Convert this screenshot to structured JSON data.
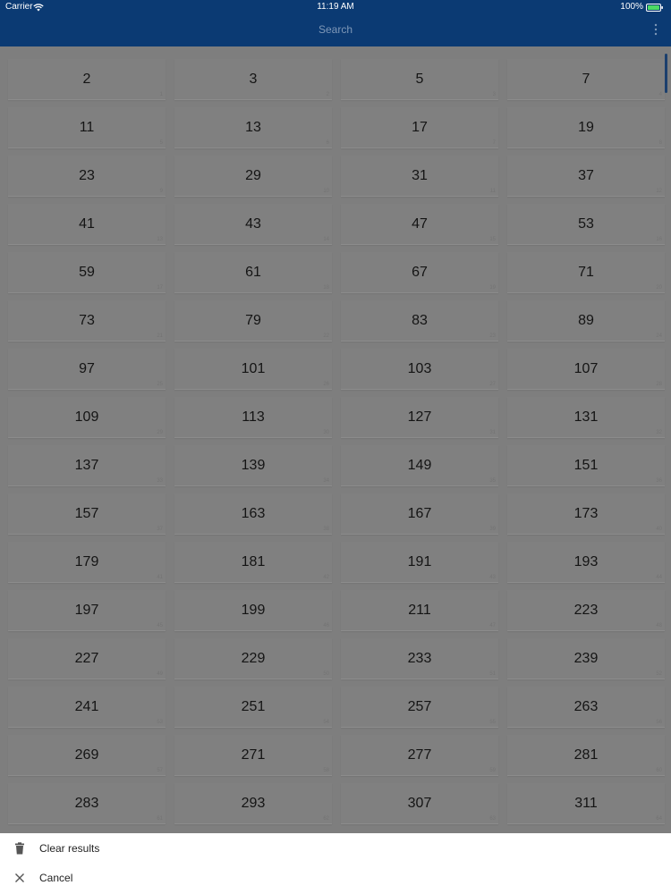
{
  "status_bar": {
    "carrier": "Carrier",
    "time": "11:19 AM",
    "battery": "100%"
  },
  "app_bar": {
    "title": "Search"
  },
  "grid": {
    "items": [
      {
        "value": "2",
        "index": "1"
      },
      {
        "value": "3",
        "index": "2"
      },
      {
        "value": "5",
        "index": "3"
      },
      {
        "value": "7",
        "index": "4"
      },
      {
        "value": "11",
        "index": "5"
      },
      {
        "value": "13",
        "index": "6"
      },
      {
        "value": "17",
        "index": "7"
      },
      {
        "value": "19",
        "index": "8"
      },
      {
        "value": "23",
        "index": "9"
      },
      {
        "value": "29",
        "index": "10"
      },
      {
        "value": "31",
        "index": "11"
      },
      {
        "value": "37",
        "index": "12"
      },
      {
        "value": "41",
        "index": "13"
      },
      {
        "value": "43",
        "index": "14"
      },
      {
        "value": "47",
        "index": "15"
      },
      {
        "value": "53",
        "index": "16"
      },
      {
        "value": "59",
        "index": "17"
      },
      {
        "value": "61",
        "index": "18"
      },
      {
        "value": "67",
        "index": "19"
      },
      {
        "value": "71",
        "index": "20"
      },
      {
        "value": "73",
        "index": "21"
      },
      {
        "value": "79",
        "index": "22"
      },
      {
        "value": "83",
        "index": "23"
      },
      {
        "value": "89",
        "index": "24"
      },
      {
        "value": "97",
        "index": "25"
      },
      {
        "value": "101",
        "index": "26"
      },
      {
        "value": "103",
        "index": "27"
      },
      {
        "value": "107",
        "index": "28"
      },
      {
        "value": "109",
        "index": "29"
      },
      {
        "value": "113",
        "index": "30"
      },
      {
        "value": "127",
        "index": "31"
      },
      {
        "value": "131",
        "index": "32"
      },
      {
        "value": "137",
        "index": "33"
      },
      {
        "value": "139",
        "index": "34"
      },
      {
        "value": "149",
        "index": "35"
      },
      {
        "value": "151",
        "index": "36"
      },
      {
        "value": "157",
        "index": "37"
      },
      {
        "value": "163",
        "index": "38"
      },
      {
        "value": "167",
        "index": "39"
      },
      {
        "value": "173",
        "index": "40"
      },
      {
        "value": "179",
        "index": "41"
      },
      {
        "value": "181",
        "index": "42"
      },
      {
        "value": "191",
        "index": "43"
      },
      {
        "value": "193",
        "index": "44"
      },
      {
        "value": "197",
        "index": "45"
      },
      {
        "value": "199",
        "index": "46"
      },
      {
        "value": "211",
        "index": "47"
      },
      {
        "value": "223",
        "index": "48"
      },
      {
        "value": "227",
        "index": "49"
      },
      {
        "value": "229",
        "index": "50"
      },
      {
        "value": "233",
        "index": "51"
      },
      {
        "value": "239",
        "index": "52"
      },
      {
        "value": "241",
        "index": "53"
      },
      {
        "value": "251",
        "index": "54"
      },
      {
        "value": "257",
        "index": "55"
      },
      {
        "value": "263",
        "index": "56"
      },
      {
        "value": "269",
        "index": "57"
      },
      {
        "value": "271",
        "index": "58"
      },
      {
        "value": "277",
        "index": "59"
      },
      {
        "value": "281",
        "index": "60"
      },
      {
        "value": "283",
        "index": "61"
      },
      {
        "value": "293",
        "index": "62"
      },
      {
        "value": "307",
        "index": "63"
      },
      {
        "value": "311",
        "index": "64"
      }
    ]
  },
  "sheet": {
    "clear_label": "Clear results",
    "cancel_label": "Cancel"
  },
  "icons": {
    "wifi": "wifi-icon",
    "battery": "battery-icon",
    "more": "more-vert-icon",
    "trash": "trash-icon",
    "close": "close-icon"
  },
  "colors": {
    "app_bar": "#0b3a73",
    "scrim": "#7f7f7f",
    "sheet": "#ffffff"
  }
}
